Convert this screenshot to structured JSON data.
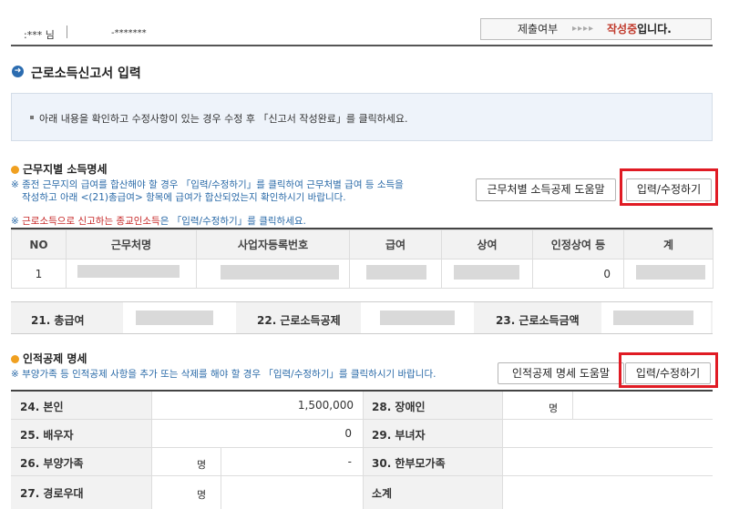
{
  "header": {
    "user_name": ":*** 님",
    "user_id": "-*******",
    "status_label": "제출여부",
    "status_arrows": "▸▸▸▸",
    "status_value": "작성중",
    "status_suffix": "입니다."
  },
  "page_title": "근로소득신고서 입력",
  "info_message": "아래 내용을 확인하고 수정사항이 있는 경우 수정 후 「신고서 작성완료」를 클릭하세요.",
  "work_section": {
    "title": "근무지별 소득명세",
    "note_line1": "※ 종전 근무지의 급여를 합산해야 할 경우 「입력/수정하기」를 클릭하여 근무처별 급여 등 소득을",
    "note_line2": "작성하고 아래 <(21)총급여> 항목에 급여가 합산되었는지 확인하시기 바랍니다.",
    "help_button": "근무처별 소득공제 도움말",
    "edit_button": "입력/수정하기",
    "religious_note_prefix": "※ ",
    "religious_note_red": "근로소득으로 신고하는 종교인소득",
    "religious_note_suffix": "은 「입력/수정하기」를 클릭하세요.",
    "columns": [
      "NO",
      "근무처명",
      "사업자등록번호",
      "급여",
      "상여",
      "인정상여 등",
      "계"
    ],
    "row": {
      "no": "1",
      "recognized_bonus": "0"
    }
  },
  "totals": {
    "total_pay_label": "21. 총급여",
    "earned_income_deduction_label": "22. 근로소득공제",
    "earned_income_amount_label": "23. 근로소득금액"
  },
  "personal_section": {
    "title": "인적공제 명세",
    "note": "※ 부양가족 등 인적공제 사항을 추가 또는 삭제를 해야 할 경우 「입력/수정하기」를 클릭하시기 바랍니다.",
    "help_button": "인적공제 명세 도움말",
    "edit_button": "입력/수정하기",
    "rows": {
      "self_label": "24. 본인",
      "self_value": "1,500,000",
      "disabled_label": "28. 장애인",
      "disabled_unit": "명",
      "spouse_label": "25. 배우자",
      "spouse_value": "0",
      "female_label": "29. 부녀자",
      "dependents_label": "26. 부양가족",
      "dependents_unit": "명",
      "dependents_value": "-",
      "single_parent_label": "30. 한부모가족",
      "elderly_label": "27. 경로우대",
      "elderly_unit": "명",
      "subtotal_label": "소계"
    }
  }
}
